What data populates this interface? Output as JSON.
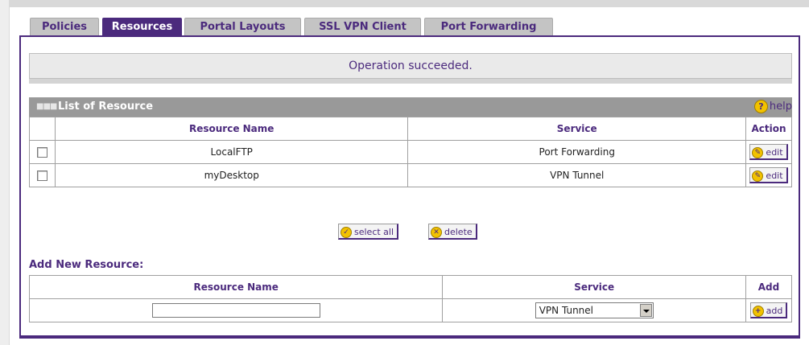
{
  "tabs": [
    {
      "label": "Policies",
      "active": false
    },
    {
      "label": "Resources",
      "active": true
    },
    {
      "label": "Portal Layouts",
      "active": false
    },
    {
      "label": "SSL VPN Client",
      "active": false
    },
    {
      "label": "Port Forwarding",
      "active": false
    }
  ],
  "status": {
    "message": "Operation succeeded."
  },
  "list": {
    "title": "List of Resource",
    "help_label": "help",
    "columns": {
      "name": "Resource Name",
      "service": "Service",
      "action": "Action"
    },
    "rows": [
      {
        "name": "LocalFTP",
        "service": "Port Forwarding",
        "action": "edit",
        "checked": false
      },
      {
        "name": "myDesktop",
        "service": "VPN Tunnel",
        "action": "edit",
        "checked": false
      }
    ],
    "select_all_label": "select all",
    "delete_label": "delete"
  },
  "add": {
    "title": "Add New Resource:",
    "columns": {
      "name": "Resource Name",
      "service": "Service",
      "add": "Add"
    },
    "name_value": "",
    "service_selected": "VPN Tunnel",
    "add_label": "add"
  },
  "colors": {
    "accent": "#4b2a7d",
    "header_bg": "#999999",
    "icon_yellow": "#f2c200"
  }
}
